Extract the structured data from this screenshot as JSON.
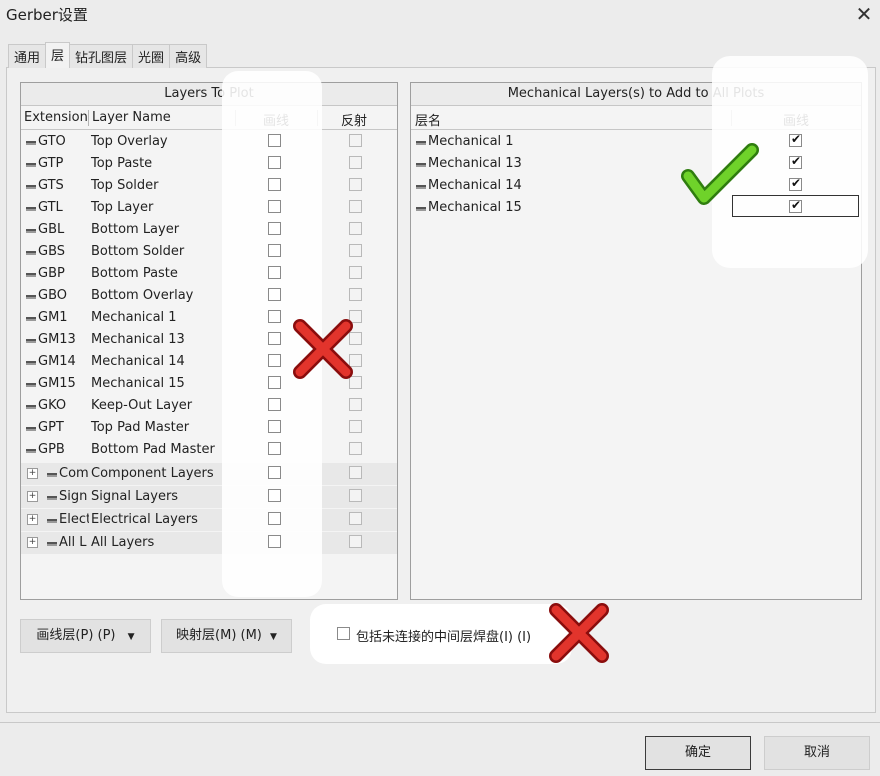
{
  "window": {
    "title": "Gerber设置",
    "close": "✕"
  },
  "tabs": [
    "通用",
    "层",
    "钻孔图层",
    "光圈",
    "高级"
  ],
  "left_panel": {
    "title": "Layers To Plot",
    "col_ext": "Extension",
    "col_name": "Layer Name",
    "col_plot": "画线",
    "col_mirror": "反射",
    "rows": [
      {
        "ext": "GTO",
        "name": "Top Overlay"
      },
      {
        "ext": "GTP",
        "name": "Top Paste"
      },
      {
        "ext": "GTS",
        "name": "Top Solder"
      },
      {
        "ext": "GTL",
        "name": "Top Layer"
      },
      {
        "ext": "GBL",
        "name": "Bottom Layer"
      },
      {
        "ext": "GBS",
        "name": "Bottom Solder"
      },
      {
        "ext": "GBP",
        "name": "Bottom Paste"
      },
      {
        "ext": "GBO",
        "name": "Bottom Overlay"
      },
      {
        "ext": "GM1",
        "name": "Mechanical 1"
      },
      {
        "ext": "GM13",
        "name": "Mechanical 13"
      },
      {
        "ext": "GM14",
        "name": "Mechanical 14"
      },
      {
        "ext": "GM15",
        "name": "Mechanical 15"
      },
      {
        "ext": "GKO",
        "name": "Keep-Out Layer"
      },
      {
        "ext": "GPT",
        "name": "Top Pad Master"
      },
      {
        "ext": "GPB",
        "name": "Bottom Pad Master"
      }
    ],
    "groups": [
      {
        "ext": "Com",
        "name": "Component Layers"
      },
      {
        "ext": "Sign",
        "name": "Signal Layers"
      },
      {
        "ext": "Elect",
        "name": "Electrical Layers"
      },
      {
        "ext": "All L",
        "name": "All Layers"
      }
    ]
  },
  "right_panel": {
    "title": "Mechanical Layers(s) to Add to All Plots",
    "col_name": "层名",
    "col_plot": "画线",
    "rows": [
      {
        "name": "Mechanical 1",
        "checked": true
      },
      {
        "name": "Mechanical 13",
        "checked": true
      },
      {
        "name": "Mechanical 14",
        "checked": true
      },
      {
        "name": "Mechanical 15",
        "checked": true
      }
    ]
  },
  "buttons": {
    "plot_layers": "画线层(P) (P)",
    "mirror_layers": "映射层(M) (M)",
    "ok": "确定",
    "cancel": "取消"
  },
  "include_option": {
    "label": "包括未连接的中间层焊盘(I) (I)",
    "checked": false
  },
  "colors": {
    "cross": "#d42020",
    "check": "#5cc41e"
  }
}
